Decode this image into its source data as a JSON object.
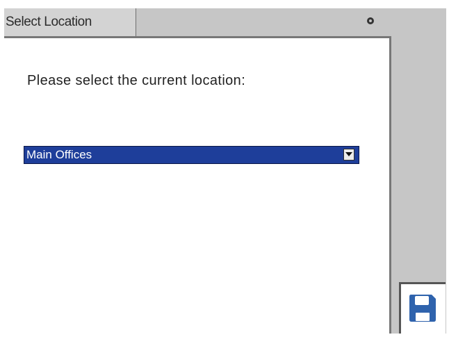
{
  "window": {
    "tab_title": "Select Location"
  },
  "main": {
    "prompt": "Please select the current location:",
    "location_select": {
      "selected_value": "Main Offices"
    }
  },
  "toolbar": {
    "save_icon": "floppy-disk-save-icon"
  },
  "colors": {
    "accent": "#1e3e9a",
    "save_icon": "#2f63ad",
    "chrome": "#c6c6c6"
  }
}
